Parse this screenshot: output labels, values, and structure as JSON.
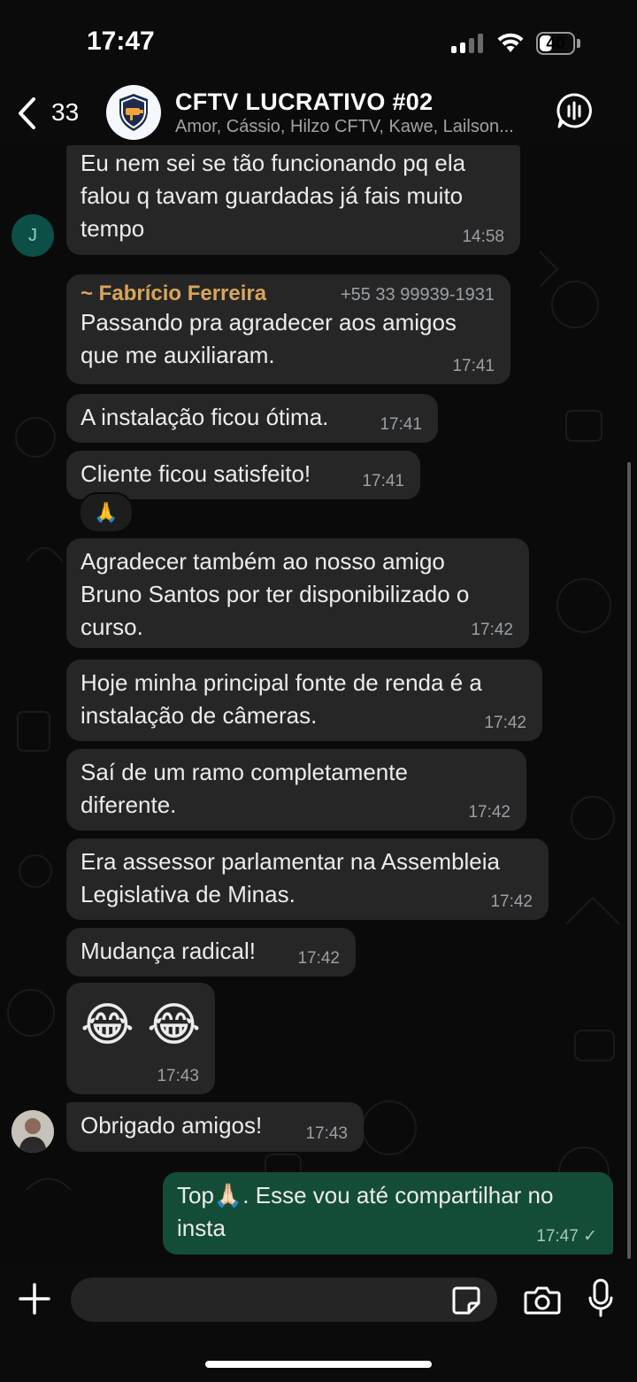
{
  "status_bar": {
    "time": "17:47",
    "battery": "40",
    "battery_level": 0.4
  },
  "header": {
    "back_count": "33",
    "group_name": "CFTV LUCRATIVO #02",
    "members": "Amor, Cássio, Hilzo CFTV, Kawe, Lailson..."
  },
  "avatars": {
    "j_initial": "J"
  },
  "messages": [
    {
      "text": "Eu nem sei se tão funcionando pq ela\nfalou q tavam guardadas já fais muito\ntempo",
      "time": "14:58"
    },
    {
      "author": "~ Fabrício Ferreira",
      "phone": "+55 33 99939-1931",
      "text": "Passando pra agradecer aos amigos\nque me auxiliaram.",
      "time": "17:41"
    },
    {
      "text": "A instalação ficou ótima.",
      "time": "17:41"
    },
    {
      "text": "Cliente ficou satisfeito!",
      "time": "17:41",
      "reaction": "🙏"
    },
    {
      "text": "Agradecer também ao nosso amigo\nBruno Santos por ter disponibilizado o\ncurso.",
      "time": "17:42"
    },
    {
      "text": "Hoje minha principal fonte de renda é a\ninstalação de câmeras.",
      "time": "17:42"
    },
    {
      "text": "Saí de um ramo completamente\ndiferente.",
      "time": "17:42"
    },
    {
      "text": "Era assessor parlamentar na Assembleia\nLegislativa de Minas.",
      "time": "17:42"
    },
    {
      "text": "Mudança radical!",
      "time": "17:42"
    },
    {
      "text": "😂 😂",
      "time": "17:43"
    },
    {
      "text": "Obrigado amigos!",
      "time": "17:43"
    },
    {
      "text": "Top🙏🏻. Esse vou até compartilhar no\ninsta",
      "time": "17:47 ✓",
      "outgoing": true
    }
  ],
  "input": {
    "placeholder": ""
  },
  "colors": {
    "incoming": "#262626",
    "outgoing": "#144d37",
    "author": "#d9a55b"
  }
}
